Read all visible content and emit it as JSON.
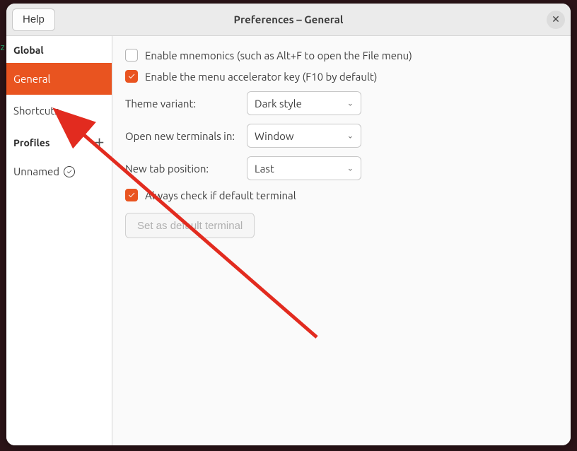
{
  "titlebar": {
    "help": "Help",
    "title": "Preferences – General"
  },
  "sidebar": {
    "global_header": "Global",
    "items": [
      {
        "label": "General",
        "active": true
      },
      {
        "label": "Shortcuts",
        "active": false
      }
    ],
    "profiles_header": "Profiles",
    "profile_items": [
      {
        "label": "Unnamed",
        "is_default": true
      }
    ]
  },
  "content": {
    "enable_mnemonics": {
      "label": "Enable mnemonics (such as Alt+F to open the File menu)",
      "checked": false
    },
    "enable_menu_accel": {
      "label": "Enable the menu accelerator key (F10 by default)",
      "checked": true
    },
    "theme_variant": {
      "label": "Theme variant:",
      "value": "Dark style"
    },
    "open_new_terminals": {
      "label": "Open new terminals in:",
      "value": "Window"
    },
    "new_tab_position": {
      "label": "New tab position:",
      "value": "Last"
    },
    "always_check_default": {
      "label": "Always check if default terminal",
      "checked": true
    },
    "set_default_button": "Set as default terminal"
  },
  "edge_text": "z"
}
